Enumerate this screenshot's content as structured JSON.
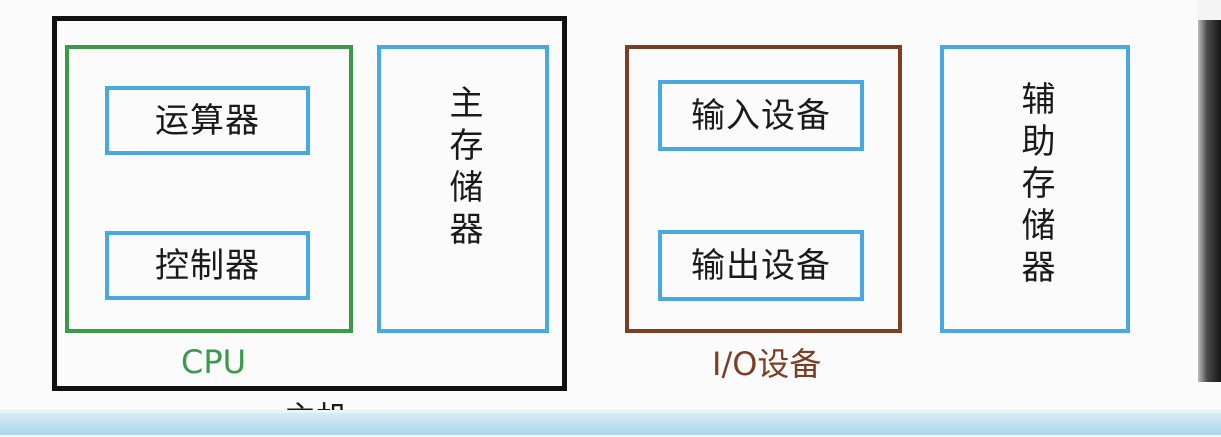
{
  "diagram": {
    "host": {
      "caption": "主机"
    },
    "cpu": {
      "caption": "CPU",
      "alu_label": "运算器",
      "control_label": "控制器"
    },
    "main_memory_label": "主存储器",
    "io": {
      "caption": "I/O设备",
      "input_label": "输入设备",
      "output_label": "输出设备"
    },
    "aux_memory_label": "辅助存储器"
  },
  "colors": {
    "cpu": "#3a9a4a",
    "component": "#4aa8e0",
    "io": "#7a3f24",
    "host": "#111111"
  }
}
